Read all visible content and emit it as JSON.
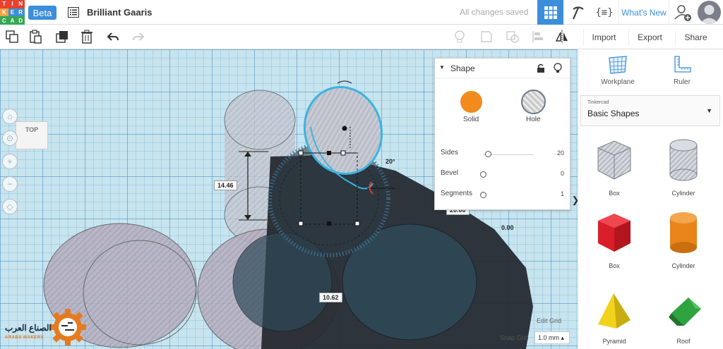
{
  "header": {
    "logo_letters": [
      "T",
      "I",
      "N",
      "K",
      "E",
      "R",
      "C",
      "A",
      "D"
    ],
    "logo_colors": [
      "#e8412f",
      "#e8412f",
      "#e8412f",
      "#f0a23a",
      "#3b8edb",
      "#3b8edb",
      "#36a853",
      "#36a853",
      "#36a853"
    ],
    "beta_label": "Beta",
    "design_title": "Brilliant Gaaris",
    "save_status": "All changes saved",
    "code_label": "{≡}",
    "whats_new": "What's New"
  },
  "toolbar": {
    "import_label": "Import",
    "export_label": "Export",
    "share_label": "Share"
  },
  "workplane": {
    "viewcube_label": "TOP",
    "dimensions": {
      "height": "14.46",
      "angle": "20°",
      "width": "20.00",
      "elevation": "0.00",
      "depth": "10.62"
    },
    "edit_grid": "Edit Grid",
    "snap_grid_label": "Snap Grid",
    "snap_grid_value": "1.0 mm ▴"
  },
  "shape_panel": {
    "title": "Shape",
    "solid_label": "Solid",
    "hole_label": "Hole",
    "params": [
      {
        "name": "Sides",
        "value": "20",
        "knob": 0.1
      },
      {
        "name": "Bevel",
        "value": "0",
        "knob": 0.0
      },
      {
        "name": "Segments",
        "value": "1",
        "knob": 0.0
      }
    ]
  },
  "right_panel": {
    "workplane_label": "Workplane",
    "ruler_label": "Ruler",
    "library_provider": "Tinkercad",
    "library_name": "Basic Shapes",
    "shapes": [
      {
        "label": "Box",
        "kind": "box-hole"
      },
      {
        "label": "Cylinder",
        "kind": "cylinder-hole"
      },
      {
        "label": "Box",
        "kind": "box"
      },
      {
        "label": "Cylinder",
        "kind": "cylinder"
      },
      {
        "label": "Pyramid",
        "kind": "pyramid"
      },
      {
        "label": "Roof",
        "kind": "roof"
      }
    ]
  },
  "watermark": {
    "arabic": "الصناع العرب",
    "english": "ARABS MAKERS"
  },
  "colors": {
    "accent": "#3b8edb",
    "solid": "#f28a1e",
    "selection": "#3ab4e0",
    "box_red": "#d91e2a",
    "cylinder_orange": "#e8841a",
    "pyramid_yellow": "#f2d21b",
    "roof_green": "#2fa33f"
  }
}
